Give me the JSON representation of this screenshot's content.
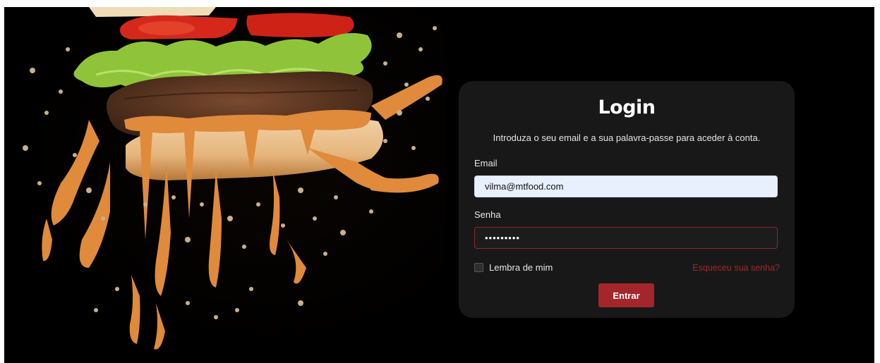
{
  "login": {
    "title": "Login",
    "subtitle": "Introduza o seu email e a sua palavra-passe para aceder à conta.",
    "email_label": "Email",
    "email_value": "vilma@mtfood.com",
    "password_label": "Senha",
    "password_value": "•••••••••",
    "remember_label": "Lembra de mim",
    "forgot_label": "Esqueceu sua senha?",
    "submit_label": "Entrar"
  },
  "colors": {
    "accent": "#a3262a",
    "card_bg": "#181818",
    "page_bg": "#000000",
    "sauce": "#e08a3c"
  }
}
